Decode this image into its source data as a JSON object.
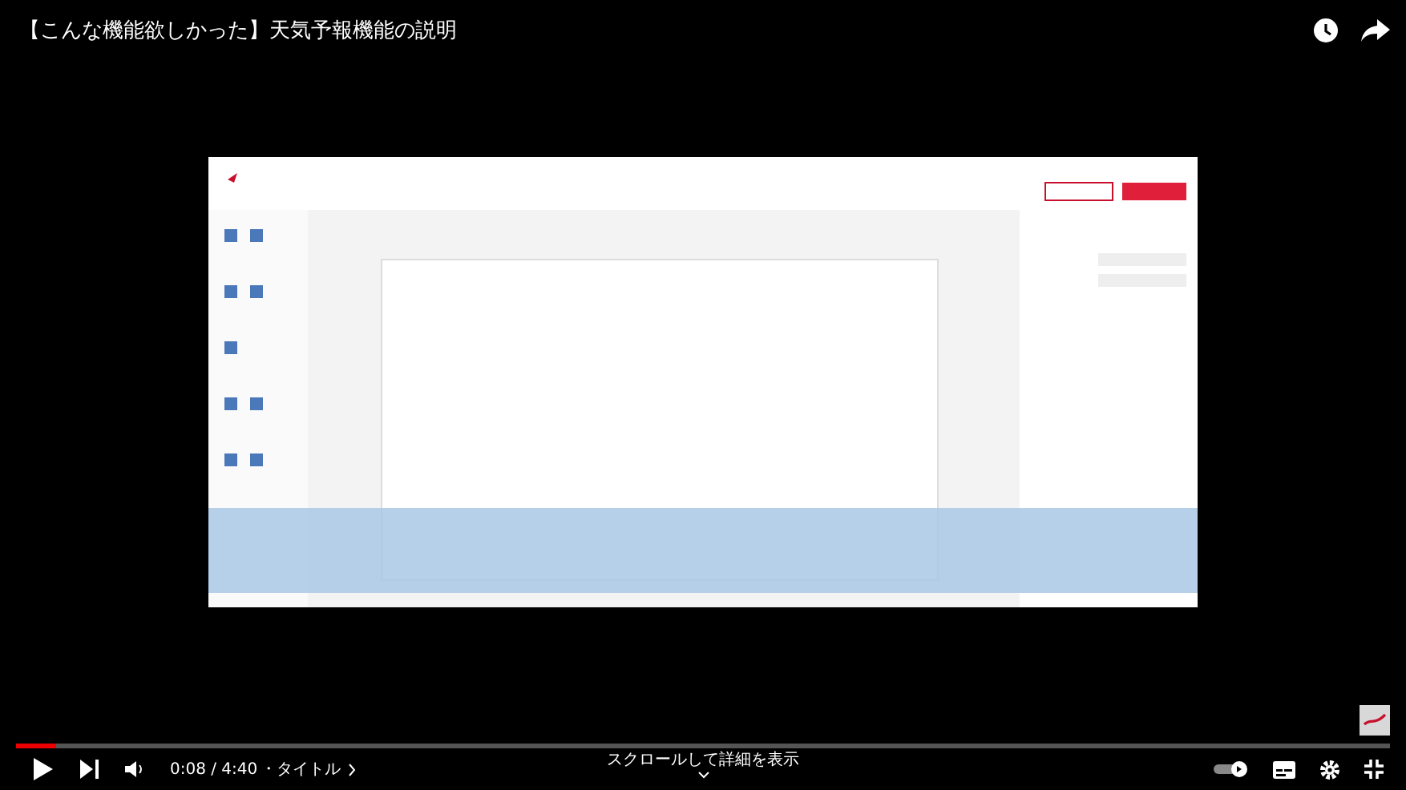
{
  "video_title": "【こんな機能欲しかった】天気予報機能の説明",
  "progress": {
    "level": 0.029
  },
  "time": "0:08 / 4:40",
  "chapter": "・タイトル",
  "scroll_hint": "スクロールして詳細を表示"
}
